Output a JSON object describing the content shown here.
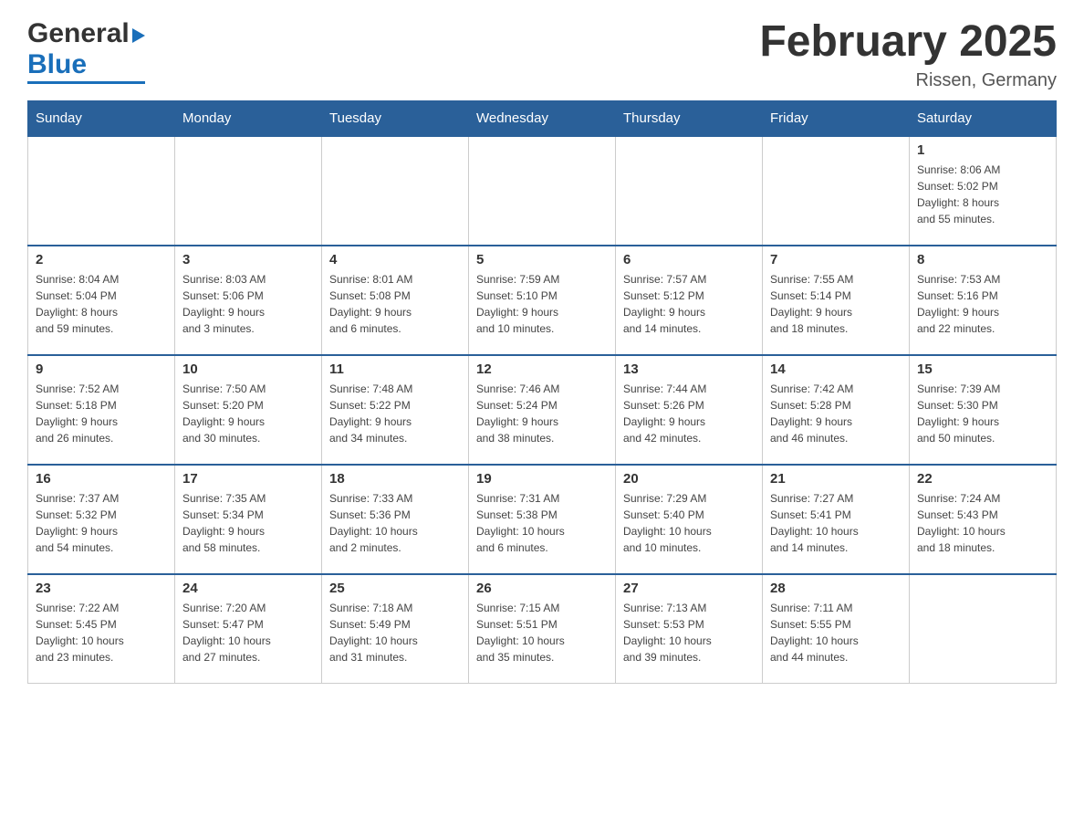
{
  "header": {
    "logo": {
      "general": "General",
      "blue": "Blue",
      "triangle": "▶"
    },
    "title": "February 2025",
    "location": "Rissen, Germany"
  },
  "calendar": {
    "days_of_week": [
      "Sunday",
      "Monday",
      "Tuesday",
      "Wednesday",
      "Thursday",
      "Friday",
      "Saturday"
    ],
    "weeks": [
      {
        "days": [
          {
            "date": "",
            "info": ""
          },
          {
            "date": "",
            "info": ""
          },
          {
            "date": "",
            "info": ""
          },
          {
            "date": "",
            "info": ""
          },
          {
            "date": "",
            "info": ""
          },
          {
            "date": "",
            "info": ""
          },
          {
            "date": "1",
            "info": "Sunrise: 8:06 AM\nSunset: 5:02 PM\nDaylight: 8 hours\nand 55 minutes."
          }
        ]
      },
      {
        "days": [
          {
            "date": "2",
            "info": "Sunrise: 8:04 AM\nSunset: 5:04 PM\nDaylight: 8 hours\nand 59 minutes."
          },
          {
            "date": "3",
            "info": "Sunrise: 8:03 AM\nSunset: 5:06 PM\nDaylight: 9 hours\nand 3 minutes."
          },
          {
            "date": "4",
            "info": "Sunrise: 8:01 AM\nSunset: 5:08 PM\nDaylight: 9 hours\nand 6 minutes."
          },
          {
            "date": "5",
            "info": "Sunrise: 7:59 AM\nSunset: 5:10 PM\nDaylight: 9 hours\nand 10 minutes."
          },
          {
            "date": "6",
            "info": "Sunrise: 7:57 AM\nSunset: 5:12 PM\nDaylight: 9 hours\nand 14 minutes."
          },
          {
            "date": "7",
            "info": "Sunrise: 7:55 AM\nSunset: 5:14 PM\nDaylight: 9 hours\nand 18 minutes."
          },
          {
            "date": "8",
            "info": "Sunrise: 7:53 AM\nSunset: 5:16 PM\nDaylight: 9 hours\nand 22 minutes."
          }
        ]
      },
      {
        "days": [
          {
            "date": "9",
            "info": "Sunrise: 7:52 AM\nSunset: 5:18 PM\nDaylight: 9 hours\nand 26 minutes."
          },
          {
            "date": "10",
            "info": "Sunrise: 7:50 AM\nSunset: 5:20 PM\nDaylight: 9 hours\nand 30 minutes."
          },
          {
            "date": "11",
            "info": "Sunrise: 7:48 AM\nSunset: 5:22 PM\nDaylight: 9 hours\nand 34 minutes."
          },
          {
            "date": "12",
            "info": "Sunrise: 7:46 AM\nSunset: 5:24 PM\nDaylight: 9 hours\nand 38 minutes."
          },
          {
            "date": "13",
            "info": "Sunrise: 7:44 AM\nSunset: 5:26 PM\nDaylight: 9 hours\nand 42 minutes."
          },
          {
            "date": "14",
            "info": "Sunrise: 7:42 AM\nSunset: 5:28 PM\nDaylight: 9 hours\nand 46 minutes."
          },
          {
            "date": "15",
            "info": "Sunrise: 7:39 AM\nSunset: 5:30 PM\nDaylight: 9 hours\nand 50 minutes."
          }
        ]
      },
      {
        "days": [
          {
            "date": "16",
            "info": "Sunrise: 7:37 AM\nSunset: 5:32 PM\nDaylight: 9 hours\nand 54 minutes."
          },
          {
            "date": "17",
            "info": "Sunrise: 7:35 AM\nSunset: 5:34 PM\nDaylight: 9 hours\nand 58 minutes."
          },
          {
            "date": "18",
            "info": "Sunrise: 7:33 AM\nSunset: 5:36 PM\nDaylight: 10 hours\nand 2 minutes."
          },
          {
            "date": "19",
            "info": "Sunrise: 7:31 AM\nSunset: 5:38 PM\nDaylight: 10 hours\nand 6 minutes."
          },
          {
            "date": "20",
            "info": "Sunrise: 7:29 AM\nSunset: 5:40 PM\nDaylight: 10 hours\nand 10 minutes."
          },
          {
            "date": "21",
            "info": "Sunrise: 7:27 AM\nSunset: 5:41 PM\nDaylight: 10 hours\nand 14 minutes."
          },
          {
            "date": "22",
            "info": "Sunrise: 7:24 AM\nSunset: 5:43 PM\nDaylight: 10 hours\nand 18 minutes."
          }
        ]
      },
      {
        "days": [
          {
            "date": "23",
            "info": "Sunrise: 7:22 AM\nSunset: 5:45 PM\nDaylight: 10 hours\nand 23 minutes."
          },
          {
            "date": "24",
            "info": "Sunrise: 7:20 AM\nSunset: 5:47 PM\nDaylight: 10 hours\nand 27 minutes."
          },
          {
            "date": "25",
            "info": "Sunrise: 7:18 AM\nSunset: 5:49 PM\nDaylight: 10 hours\nand 31 minutes."
          },
          {
            "date": "26",
            "info": "Sunrise: 7:15 AM\nSunset: 5:51 PM\nDaylight: 10 hours\nand 35 minutes."
          },
          {
            "date": "27",
            "info": "Sunrise: 7:13 AM\nSunset: 5:53 PM\nDaylight: 10 hours\nand 39 minutes."
          },
          {
            "date": "28",
            "info": "Sunrise: 7:11 AM\nSunset: 5:55 PM\nDaylight: 10 hours\nand 44 minutes."
          },
          {
            "date": "",
            "info": ""
          }
        ]
      }
    ]
  }
}
